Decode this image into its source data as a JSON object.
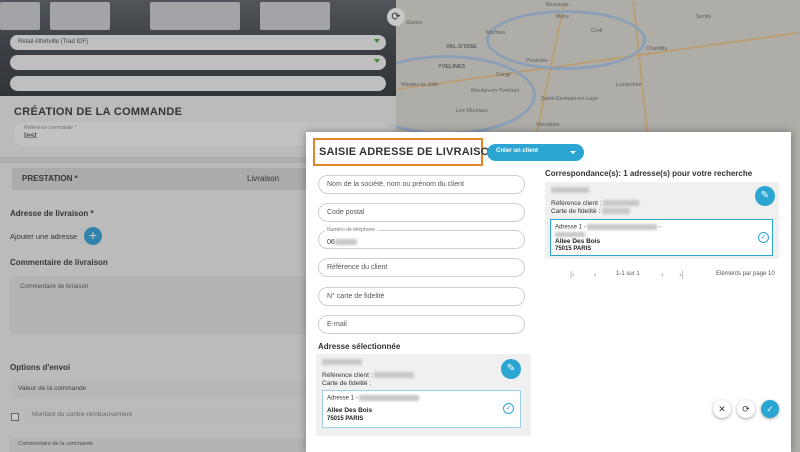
{
  "background": {
    "selects": [
      "Retail Alfortville (Trad IDF)",
      "",
      ""
    ],
    "section_title": "CRÉATION DE LA COMMANDE",
    "reference": {
      "label": "Référence commande *",
      "value": "test"
    },
    "prestation": {
      "label": "PRESTATION *",
      "value": "Livraison"
    },
    "delivery_address": {
      "title": "Adresse de livraison *",
      "add_label": "Ajouter une adresse",
      "add_icon": "plus-icon"
    },
    "comment": {
      "title": "Commentaire de livraison",
      "placeholder": "Commentaire de livraison"
    },
    "options": {
      "title": "Options d'envoi",
      "order_value": "Valeur de la commande",
      "cod_amount": "Montant du contre-remboursement",
      "order_comment": "Commentaire de la commande"
    },
    "map_labels": [
      "Beauvais",
      "Senlis",
      "Chantilly",
      "Creil",
      "Pontoise",
      "Cergy",
      "VAL-D'OISE",
      "YVELINES",
      "Mantes-la-Jolie",
      "Les Mureaux",
      "Saint-Germain-en-Laye",
      "Versailles",
      "Meulan-en-Yvelines",
      "Gisors",
      "Marines",
      "Luzarches",
      "Méru"
    ]
  },
  "modal": {
    "title": "SAISIE ADRESSE DE LIVRAISON",
    "create_client_label": "Créer un client",
    "fields": {
      "company": "Nom de la société, nom ou prénom du client",
      "postal_code": "Code postal",
      "phone_label": "Numéro de téléphone",
      "phone_value": "06",
      "client_reference": "Référence du client",
      "fidelity": "N° carte de fidelité",
      "email": "E-mail"
    },
    "selected": {
      "title": "Adresse sélectionnée",
      "client_ref_label": "Référence client :",
      "fidelity_label": "Carte de fidelité :",
      "address_prefix": "Adresse 1 -",
      "street": "Allee Des Bois",
      "city": "75015 PARIS"
    },
    "results": {
      "title": "Correspondance(s): 1 adresse(s) pour votre recherche",
      "client_ref_label": "Référence client :",
      "fidelity_label": "Carte de fidelité :",
      "address_prefix": "Adresse 1 -",
      "address_suffix": "-",
      "street": "Allee Des Bois",
      "city": "75015 PARIS"
    },
    "pagination": {
      "range": "1-1 sur 1",
      "per_page": "Eléments par page 10"
    },
    "icons": {
      "close": "close-icon",
      "refresh": "refresh-icon",
      "confirm": "check-icon",
      "edit": "pencil-icon"
    }
  },
  "colors": {
    "accent": "#2ba6d2",
    "highlight_border": "#e2852b",
    "select_chevron": "#4a9c2c"
  }
}
